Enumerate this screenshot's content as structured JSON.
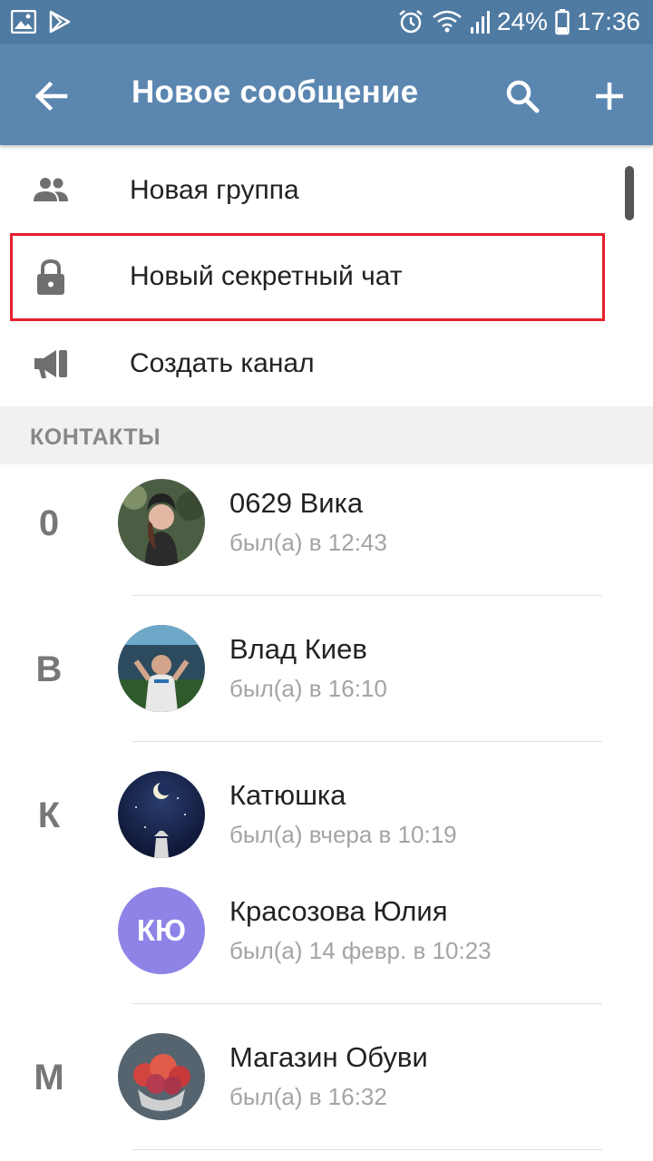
{
  "status_bar": {
    "battery": "24%",
    "time": "17:36",
    "left_icons": [
      "gallery-icon",
      "play-store-icon"
    ],
    "right_icons": [
      "alarm-icon",
      "wifi-icon",
      "signal-icon",
      "battery-icon"
    ]
  },
  "app_bar": {
    "title": "Новое сообщение",
    "background": "#5b86b0"
  },
  "menu": {
    "new_group": "Новая группа",
    "new_secret_chat": "Новый секретный чат",
    "create_channel": "Создать канал",
    "highlight_color": "#e5202f"
  },
  "contacts": {
    "header": "КОНТАКТЫ",
    "items": [
      {
        "letter": "0",
        "name": "0629 Вика",
        "status": "был(а) в 12:43"
      },
      {
        "letter": "В",
        "name": "Влад Киев",
        "status": "был(а) в 16:10"
      },
      {
        "letter": "К",
        "name": "Катюшка",
        "status": "был(а) вчера в 10:19"
      },
      {
        "letter": "",
        "name": "Красозова Юлия",
        "status": "был(а) 14 февр. в 10:23",
        "initials": "КЮ",
        "avatar_color": "#8e83e6"
      },
      {
        "letter": "М",
        "name": "Магазин Обуви",
        "status": "был(а) в 16:32"
      }
    ]
  }
}
